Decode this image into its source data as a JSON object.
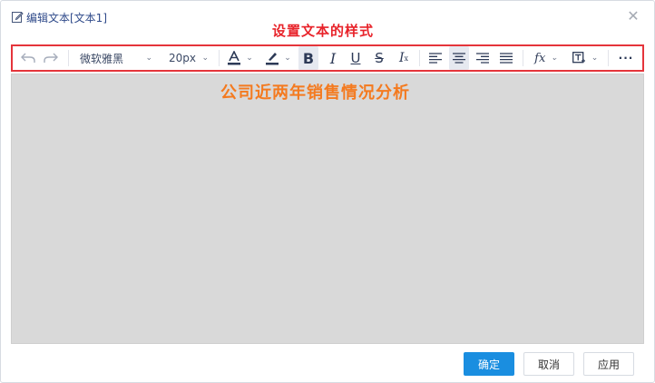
{
  "dialog": {
    "title": "编辑文本[文本1]",
    "annotation": "设置文本的样式",
    "content_text": "公司近两年销售情况分析"
  },
  "toolbar": {
    "font_family": "微软雅黑",
    "font_size": "20px",
    "icons": [
      "undo-icon",
      "redo-icon",
      "font-color-icon",
      "highlight-icon",
      "bold-icon",
      "italic-icon",
      "underline-icon",
      "strikethrough-icon",
      "clear-format-icon",
      "align-left-icon",
      "align-center-icon",
      "align-right-icon",
      "justify-icon",
      "formula-icon",
      "insert-field-icon",
      "more-icon"
    ]
  },
  "buttons": {
    "confirm": "确定",
    "cancel": "取消",
    "apply": "应用"
  },
  "colors": {
    "annotation_red": "#e8232a",
    "content_orange": "#f47a1f",
    "primary_blue": "#1a8ee0",
    "editor_bg": "#d9d9d9"
  }
}
